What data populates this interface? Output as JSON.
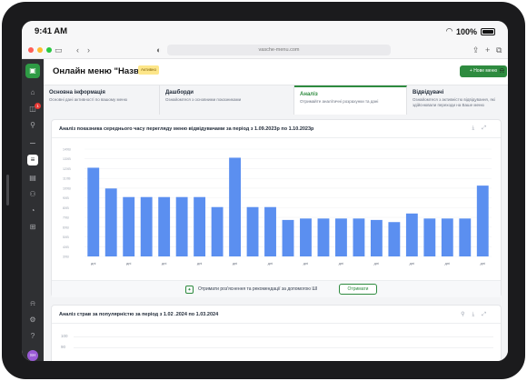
{
  "status_bar": {
    "time": "9:41 AM",
    "battery": "100%"
  },
  "browser": {
    "url": "vasche-menu.com"
  },
  "colors": {
    "brand_green": "#2e8b3f",
    "bar_blue": "#5b8ff0",
    "sidebar_bg": "#2f3033",
    "badge_yellow": "#fde68a"
  },
  "sidebar": {
    "logo": "logo-icon",
    "icons": [
      "home-icon",
      "notification-icon",
      "sitemap-icon",
      "chart-icon",
      "menu-icon",
      "book-icon",
      "users-icon",
      "pie-icon",
      "grid-icon"
    ],
    "badge_count": "1",
    "avatar_initials": "SH",
    "bottom_icons": [
      "bell-icon",
      "settings-icon",
      "help-icon"
    ]
  },
  "header": {
    "title": "Онлайн меню \"Назва\"",
    "status_badge": "Активно",
    "new_menu_button": "+ Нове меню"
  },
  "tabs": [
    {
      "title": "Основна інформація",
      "subtitle": "Основні дані активності по вашому меню"
    },
    {
      "title": "Дашборди",
      "subtitle": "Ознайомтеся з основними показниками"
    },
    {
      "title": "Аналіз",
      "subtitle": "Отримайте аналітичні розрахунки та дані"
    },
    {
      "title": "Відвідувачі",
      "subtitle": "Ознайомтеся з активністю відвідування, які здійснювали переходи на Ваше меню"
    }
  ],
  "chart_card": {
    "title": "Аналіз показника середнього часу перегляду меню відвідувачами за період з 1.09.2023р по 1.10.2023р",
    "ai_text": "Отримати роз'яснення та рекомендації за допомогою ШІ",
    "ai_button": "Отримати"
  },
  "chart_data": {
    "type": "bar",
    "categories": [
      "дні",
      "",
      "дні",
      "",
      "дні",
      "",
      "дні",
      "",
      "дні",
      "",
      "дні",
      "",
      "дні",
      "",
      "дні",
      "",
      "дні",
      "",
      "дні",
      "",
      "дні",
      "",
      "дні"
    ],
    "y_tick_labels": [
      "14ХВ",
      "13ХВ",
      "12ХВ",
      "11ХВ",
      "10ХВ",
      "9ХВ",
      "8ХВ",
      "7ХВ",
      "6ХВ",
      "5ХВ",
      "4ХВ",
      "3ХВ"
    ],
    "values": [
      12.4,
      9.5,
      8.3,
      8.3,
      8.3,
      8.3,
      8.3,
      6.9,
      13.8,
      6.9,
      6.9,
      5.1,
      5.3,
      5.3,
      5.3,
      5.3,
      5.1,
      4.8,
      6.0,
      5.3,
      5.3,
      5.3,
      9.9
    ],
    "ylim": [
      0,
      15
    ],
    "grid": true
  },
  "second_card": {
    "title": "Аналіз страв за популярністю за період з 1.02 .2024 по 1.03.2024",
    "y_ticks": [
      "100",
      "90"
    ]
  }
}
